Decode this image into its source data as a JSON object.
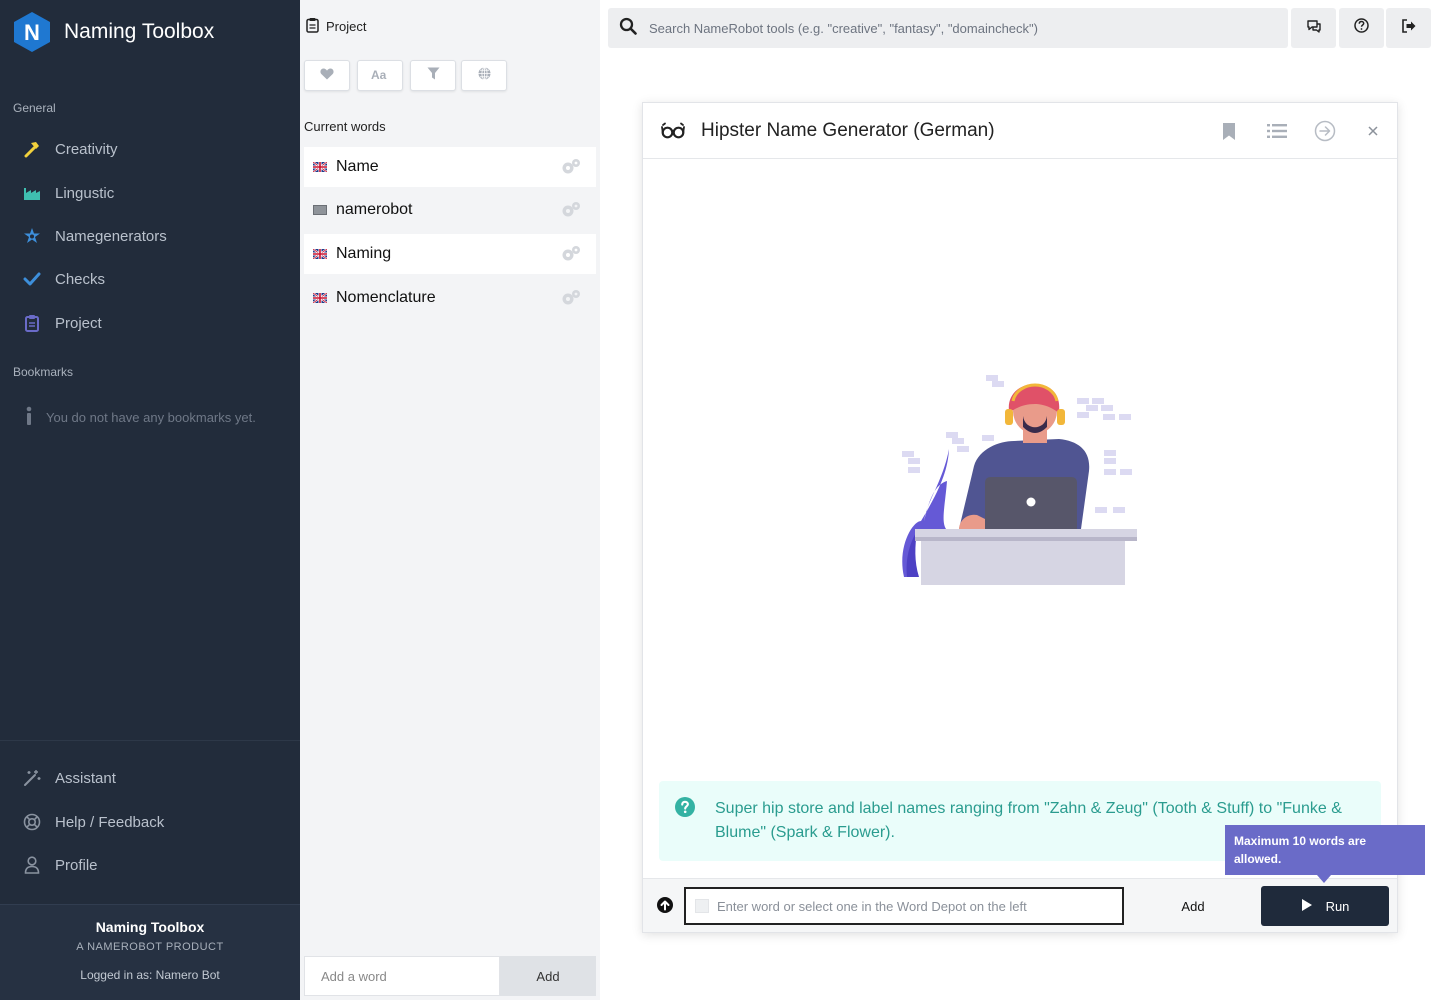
{
  "app": {
    "logo_letter": "N",
    "title": "Naming Toolbox",
    "colors": {
      "sidebar_bg": "#222c3b",
      "accent_purple": "#6a6bc8",
      "teal_text": "#2a9c8f",
      "logo_blue": "#1f78d1"
    }
  },
  "sidebar": {
    "general_title": "General",
    "general_items": [
      {
        "label": "Creativity",
        "icon": "hammer-icon",
        "color": "#f2d13c"
      },
      {
        "label": "Lingustic",
        "icon": "factory-chart-icon",
        "color": "#3fbfb0"
      },
      {
        "label": "Namegenerators",
        "icon": "star-gear-icon",
        "color": "#3d8fdb"
      },
      {
        "label": "Checks",
        "icon": "check-icon",
        "color": "#3d8fdb"
      },
      {
        "label": "Project",
        "icon": "clipboard-icon",
        "color": "#6a6bc8"
      }
    ],
    "bookmarks_title": "Bookmarks",
    "bookmarks_empty": "You do not have any bookmarks yet.",
    "bottom_items": [
      {
        "label": "Assistant",
        "icon": "magic-wand-icon"
      },
      {
        "label": "Help / Feedback",
        "icon": "lifebuoy-icon"
      },
      {
        "label": "Profile",
        "icon": "user-icon"
      }
    ],
    "footer": {
      "title": "Naming Toolbox",
      "subtitle": "A NAMEROBOT PRODUCT",
      "logged_in": "Logged in as: Namero Bot"
    }
  },
  "project": {
    "title": "Project",
    "toolbar": [
      "heart-icon",
      "font-case-icon",
      "filter-icon",
      "globe-icon"
    ],
    "current_words_label": "Current words",
    "words": [
      {
        "word": "Name",
        "flag": "uk-flag-icon"
      },
      {
        "word": "namerobot",
        "flag": "neutral-flag-icon"
      },
      {
        "word": "Naming",
        "flag": "uk-flag-icon"
      },
      {
        "word": "Nomenclature",
        "flag": "uk-flag-icon"
      }
    ],
    "add_placeholder": "Add a word",
    "add_button": "Add"
  },
  "topbar": {
    "search_placeholder": "Search NameRobot tools (e.g. \"creative\", \"fantasy\", \"domaincheck\")",
    "buttons": [
      "chat-icon",
      "help-circle-icon",
      "logout-icon"
    ]
  },
  "tool": {
    "title": "Hipster Name Generator (German)",
    "header_actions": [
      "bookmark-icon",
      "list-icon",
      "arrow-circle-icon",
      "close-icon"
    ],
    "description": "Super hip store and label names ranging from \"Zahn & Zeug\" (Tooth & Stuff) to \"Funke & Blume\" (Spark & Flower).",
    "input_placeholder": "Enter word or select one in the Word Depot on the left",
    "add_button": "Add",
    "run_button": "Run",
    "tooltip": "Maximum 10 words are allowed."
  }
}
